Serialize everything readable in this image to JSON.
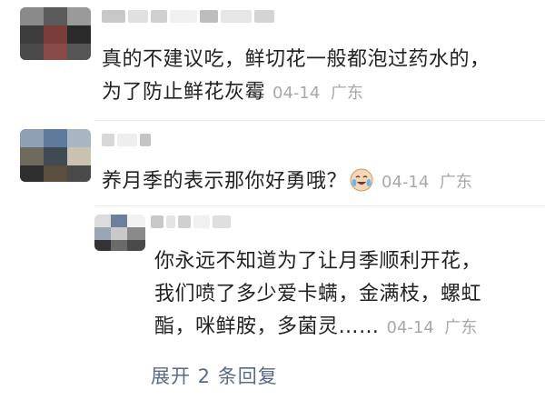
{
  "comments": [
    {
      "text_line1": "真的不建议吃，鲜切花一般都泡过药水的，",
      "text_line2": "为了防止鲜花灰霉",
      "date": "04-14",
      "location": "广东"
    },
    {
      "text": "养月季的表示那你好勇哦？",
      "emoji": "crying-laughing-emoji",
      "date": "04-14",
      "location": "广东"
    }
  ],
  "reply": {
    "text_line1": "你永远不知道为了让月季顺利开花，",
    "text_line2": "我们喷了多少爱卡螨，金满枝，螺虹",
    "text_line3": "酯，咪鲜胺，多菌灵……",
    "date": "04-14",
    "location": "广东"
  },
  "expand_label": "展开 2 条回复"
}
